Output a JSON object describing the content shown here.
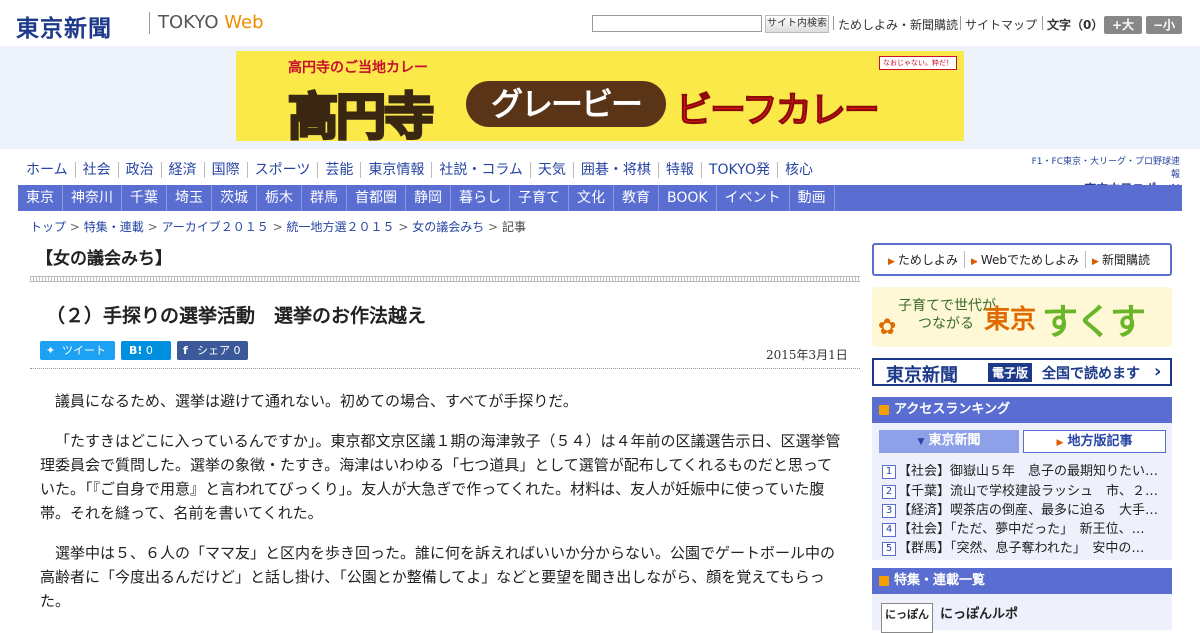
{
  "header": {
    "logo": "東京新聞",
    "logo_tokyo": "TOKYO",
    "logo_web": "Web",
    "search_placeholder": "",
    "search_button": "サイト内検索",
    "links": [
      "ためしよみ・新聞購読",
      "サイトマップ"
    ],
    "font_label": "文字（0）",
    "font_bigger": "+大",
    "font_smaller": "−小"
  },
  "banner": {
    "top_text": "高円寺のご当地カレー",
    "big_text": "高円寺",
    "pill_text": "グレービー",
    "curry_text": "ビーフカレー",
    "small_logo": "なおじゃない。粋だ！"
  },
  "nav_main": [
    "ホーム",
    "社会",
    "政治",
    "経済",
    "国際",
    "スポーツ",
    "芸能",
    "東京情報",
    "社説・コラム",
    "天気",
    "囲碁・将棋",
    "特報",
    "TOKYO発",
    "核心"
  ],
  "chunichi": {
    "line1": "F1・FC東京・大リーグ・プロ野球速報",
    "line2": "東京中日スポーツ"
  },
  "nav_sub": [
    "東京",
    "神奈川",
    "千葉",
    "埼玉",
    "茨城",
    "栃木",
    "群馬",
    "首都圏",
    "静岡",
    "暮らし",
    "子育て",
    "文化",
    "教育",
    "BOOK",
    "イベント",
    "動画"
  ],
  "breadcrumb": {
    "items": [
      "トップ",
      "特集・連載",
      "アーカイブ２０１５",
      "統一地方選２０１５",
      "女の議会みち"
    ],
    "sep": ">",
    "current": "記事"
  },
  "article": {
    "section": "【女の議会みち】",
    "headline": "（２）手探りの選挙活動　選挙のお作法越え",
    "share": {
      "tweet": "ツイート",
      "hatena_icon": "B!",
      "hatena_count": "0",
      "facebook_icon": "f",
      "facebook": "シェア 0"
    },
    "date": "2015年3月1日",
    "paragraphs": [
      "議員になるため、選挙は避けて通れない。初めての場合、すべてが手探りだ。",
      "「たすきはどこに入っているんですか」。東京都文京区議１期の海津敦子（５４）は４年前の区議選告示日、区選挙管理委員会で質問した。選挙の象徴・たすき。海津はいわゆる「七つ道具」として選管が配布してくれるものだと思っていた。「『ご自身で用意』と言われてびっくり」。友人が大急ぎで作ってくれた。材料は、友人が妊娠中に使っていた腹帯。それを縫って、名前を書いてくれた。",
      "選挙中は５、６人の「ママ友」と区内を歩き回った。誰に何を訴えればいいか分からない。公園でゲートボール中の高齢者に「今度出るんだけど」と話し掛け、「公園とか整備してよ」などと要望を聞き出しながら、顔を覚えてもらった。"
    ]
  },
  "sidebar": {
    "sub_links": [
      "ためしよみ",
      "Webでためしよみ",
      "新聞購読"
    ],
    "sukusuku": {
      "line1": "子育てで世代が",
      "line2": "つながる",
      "tokyo": "東京",
      "name": "すくすく"
    },
    "ebook": {
      "name": "東京新聞",
      "badge": "電子版",
      "text": "全国で読めます",
      "arrow": "›"
    },
    "ranking": {
      "title": "アクセスランキング",
      "tabs": [
        "東京新聞",
        "地方版記事"
      ],
      "items": [
        {
          "num": "1",
          "text": "【社会】御嶽山５年　息子の最期知りたい…"
        },
        {
          "num": "2",
          "text": "【千葉】流山で学校建設ラッシュ　市、２…"
        },
        {
          "num": "3",
          "text": "【経済】喫茶店の倒産、最多に迫る　大手…"
        },
        {
          "num": "4",
          "text": "【社会】「ただ、夢中だった」　新王位、…"
        },
        {
          "num": "5",
          "text": "【群馬】「突然、息子奪われた」　安中の…"
        }
      ]
    },
    "feature": {
      "title": "特集・連載一覧",
      "item_img": "にっぽん",
      "item_title": "にっぽんルポ"
    }
  }
}
